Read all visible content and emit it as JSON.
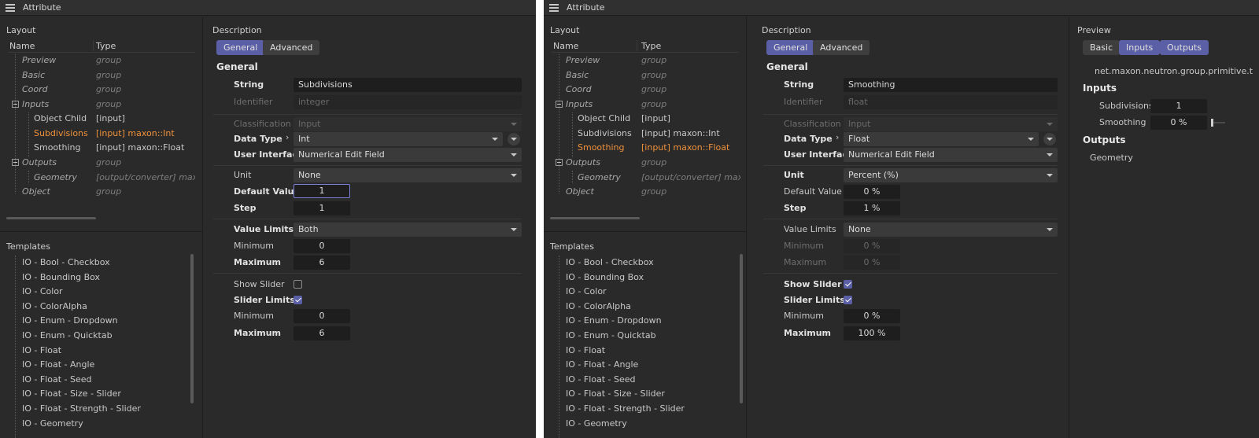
{
  "left": {
    "title": "Attribute",
    "layout_label": "Layout",
    "col_name": "Name",
    "col_type": "Type",
    "tree": [
      {
        "name": "Preview",
        "type": "group"
      },
      {
        "name": "Basic",
        "type": "group"
      },
      {
        "name": "Coord",
        "type": "group"
      },
      {
        "name": "Inputs",
        "type": "group"
      },
      {
        "name": "Object Child",
        "type": "[input]"
      },
      {
        "name": "Subdivisions",
        "type": "[input] maxon::Int"
      },
      {
        "name": "Smoothing",
        "type": "[input] maxon::Float"
      },
      {
        "name": "Outputs",
        "type": "group"
      },
      {
        "name": "Geometry",
        "type": "[output/converter] maxon::G"
      },
      {
        "name": "Object",
        "type": "group"
      }
    ],
    "templates_label": "Templates",
    "templates": [
      "IO - Bool - Checkbox",
      "IO - Bounding Box",
      "IO - Color",
      "IO - ColorAlpha",
      "IO - Enum - Dropdown",
      "IO - Enum - Quicktab",
      "IO - Float",
      "IO - Float - Angle",
      "IO - Float - Seed",
      "IO - Float - Size - Slider",
      "IO - Float - Strength - Slider",
      "IO - Geometry"
    ],
    "desc": {
      "label": "Description",
      "tab_general": "General",
      "tab_advanced": "Advanced",
      "heading": "General",
      "string_label": "String",
      "string_value": "Subdivisions",
      "identifier_label": "Identifier",
      "identifier_value": "integer",
      "classification_label": "Classification",
      "classification_value": "Input",
      "datatype_label": "Data Type",
      "datatype_value": "Int",
      "ui_label": "User Interface",
      "ui_value": "Numerical Edit Field",
      "unit_label": "Unit",
      "unit_value": "None",
      "default_label": "Default Value",
      "default_value": "1",
      "step_label": "Step",
      "step_value": "1",
      "limits_label": "Value Limits",
      "limits_value": "Both",
      "min_label": "Minimum",
      "min_value": "0",
      "max_label": "Maximum",
      "max_value": "6",
      "showslider_label": "Show Slider",
      "sliderlimits_label": "Slider Limits",
      "smin_label": "Minimum",
      "smin_value": "0",
      "smax_label": "Maximum",
      "smax_value": "6"
    }
  },
  "right": {
    "title": "Attribute",
    "layout_label": "Layout",
    "col_name": "Name",
    "col_type": "Type",
    "tree": [
      {
        "name": "Preview",
        "type": "group"
      },
      {
        "name": "Basic",
        "type": "group"
      },
      {
        "name": "Coord",
        "type": "group"
      },
      {
        "name": "Inputs",
        "type": "group"
      },
      {
        "name": "Object Child",
        "type": "[input]"
      },
      {
        "name": "Subdivisions",
        "type": "[input] maxon::Int"
      },
      {
        "name": "Smoothing",
        "type": "[input] maxon::Float"
      },
      {
        "name": "Outputs",
        "type": "group"
      },
      {
        "name": "Geometry",
        "type": "[output/converter] maxon::G"
      },
      {
        "name": "Object",
        "type": "group"
      }
    ],
    "templates_label": "Templates",
    "templates": [
      "IO - Bool - Checkbox",
      "IO - Bounding Box",
      "IO - Color",
      "IO - ColorAlpha",
      "IO - Enum - Dropdown",
      "IO - Enum - Quicktab",
      "IO - Float",
      "IO - Float - Angle",
      "IO - Float - Seed",
      "IO - Float - Size - Slider",
      "IO - Float - Strength - Slider",
      "IO - Geometry"
    ],
    "desc": {
      "label": "Description",
      "tab_general": "General",
      "tab_advanced": "Advanced",
      "heading": "General",
      "string_label": "String",
      "string_value": "Smoothing",
      "identifier_label": "Identifier",
      "identifier_value": "float",
      "classification_label": "Classification",
      "classification_value": "Input",
      "datatype_label": "Data Type",
      "datatype_value": "Float",
      "ui_label": "User Interface",
      "ui_value": "Numerical Edit Field",
      "unit_label": "Unit",
      "unit_value": "Percent (%)",
      "default_label": "Default Value",
      "default_value": "0 %",
      "step_label": "Step",
      "step_value": "1 %",
      "limits_label": "Value Limits",
      "limits_value": "None",
      "min_label": "Minimum",
      "min_value": "0 %",
      "max_label": "Maximum",
      "max_value": "0 %",
      "showslider_label": "Show Slider",
      "sliderlimits_label": "Slider Limits",
      "smin_label": "Minimum",
      "smin_value": "0 %",
      "smax_label": "Maximum",
      "smax_value": "100 %"
    },
    "preview": {
      "label": "Preview",
      "tab_basic": "Basic",
      "tab_inputs": "Inputs",
      "tab_outputs": "Outputs",
      "node_id": "net.maxon.neutron.group.primitive.t",
      "inputs_heading": "Inputs",
      "subdivisions_label": "Subdivisions",
      "subdivisions_value": "1",
      "smoothing_label": "Smoothing",
      "smoothing_value": "0 %",
      "outputs_heading": "Outputs",
      "geometry_label": "Geometry"
    }
  },
  "colors": {
    "accent": "#5b5fa6",
    "highlight": "#f0913a",
    "background": "#2a2a2a"
  }
}
